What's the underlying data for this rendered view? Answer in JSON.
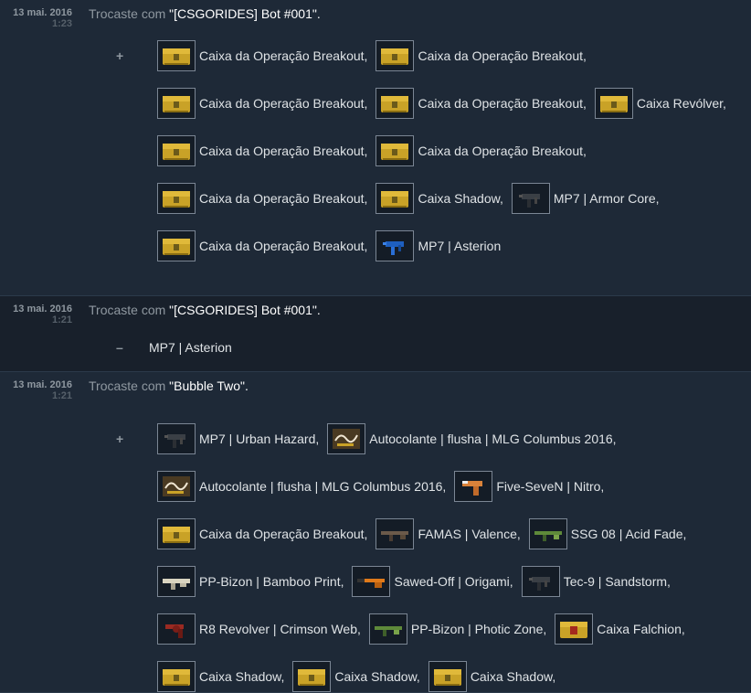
{
  "trades": [
    {
      "date": "13 mai. 2016",
      "time": "1:23",
      "prefix": "Trocaste com ",
      "partner": "\"[CSGORIDES] Bot #001\".",
      "sign": "+",
      "rows": [
        [
          {
            "name": "Caixa da Operação Breakout,",
            "icon": "case-icon"
          },
          {
            "name": "Caixa da Operação Breakout,",
            "icon": "case-icon"
          }
        ],
        [
          {
            "name": "Caixa da Operação Breakout,",
            "icon": "case-icon"
          },
          {
            "name": "Caixa da Operação Breakout,",
            "icon": "case-icon"
          },
          {
            "name": "Caixa Revólver,",
            "icon": "case-icon"
          }
        ],
        [
          {
            "name": "Caixa da Operação Breakout,",
            "icon": "case-icon"
          },
          {
            "name": "Caixa da Operação Breakout,",
            "icon": "case-icon"
          }
        ],
        [
          {
            "name": "Caixa da Operação Breakout,",
            "icon": "case-icon"
          },
          {
            "name": "Caixa Shadow,",
            "icon": "case-icon"
          },
          {
            "name": "MP7 | Armor Core,",
            "icon": "smg-icon"
          }
        ],
        [
          {
            "name": "Caixa da Operação Breakout,",
            "icon": "case-icon"
          },
          {
            "name": "MP7 | Asterion",
            "icon": "smg-blue-icon"
          }
        ]
      ]
    },
    {
      "date": "13 mai. 2016",
      "time": "1:21",
      "prefix": "Trocaste com ",
      "partner": "\"[CSGORIDES] Bot #001\".",
      "sign": "–",
      "item": "MP7 | Asterion"
    },
    {
      "date": "13 mai. 2016",
      "time": "1:21",
      "prefix": "Trocaste com ",
      "partner": "\"Bubble Two\".",
      "sign": "+",
      "rows": [
        [
          {
            "name": "MP7 | Urban Hazard,",
            "icon": "smg-icon"
          },
          {
            "name": "Autocolante | flusha | MLG Columbus 2016,",
            "icon": "sticker-icon"
          }
        ],
        [
          {
            "name": "Autocolante | flusha | MLG Columbus 2016,",
            "icon": "sticker-icon"
          },
          {
            "name": "Five-SeveN | Nitro,",
            "icon": "pistol-icon"
          }
        ],
        [
          {
            "name": "Caixa da Operação Breakout,",
            "icon": "case-icon"
          },
          {
            "name": "FAMAS | Valence,",
            "icon": "rifle-icon"
          },
          {
            "name": "SSG 08 | Acid Fade,",
            "icon": "rifle-green-icon"
          }
        ],
        [
          {
            "name": "PP-Bizon | Bamboo Print,",
            "icon": "rifle-light-icon"
          },
          {
            "name": "Sawed-Off | Origami,",
            "icon": "shotgun-icon"
          },
          {
            "name": "Tec-9 | Sandstorm,",
            "icon": "smg-icon"
          }
        ],
        [
          {
            "name": "R8 Revolver | Crimson Web,",
            "icon": "revolver-icon"
          },
          {
            "name": "PP-Bizon | Photic Zone,",
            "icon": "rifle-green-icon"
          },
          {
            "name": "Caixa Falchion,",
            "icon": "case-red-icon"
          }
        ],
        [
          {
            "name": "Caixa Shadow,",
            "icon": "case-icon"
          },
          {
            "name": "Caixa Shadow,",
            "icon": "case-icon"
          },
          {
            "name": "Caixa Shadow,",
            "icon": "case-icon"
          }
        ]
      ]
    }
  ]
}
